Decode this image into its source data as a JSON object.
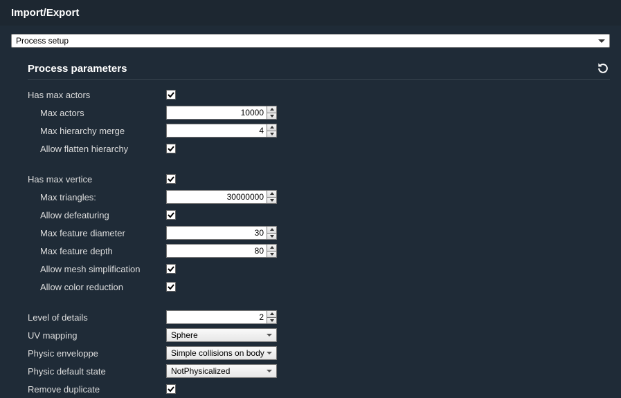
{
  "header": {
    "title": "Import/Export"
  },
  "mainDropdown": {
    "value": "Process setup"
  },
  "section": {
    "title": "Process parameters"
  },
  "p": {
    "hasMaxActors": {
      "label": "Has max actors",
      "checked": true
    },
    "maxActors": {
      "label": "Max actors",
      "value": "10000"
    },
    "maxHierarchyMerge": {
      "label": "Max hierarchy merge",
      "value": "4"
    },
    "allowFlatten": {
      "label": "Allow flatten hierarchy",
      "checked": true
    },
    "hasMaxVertice": {
      "label": "Has max vertice",
      "checked": true
    },
    "maxTriangles": {
      "label": "Max triangles:",
      "value": "30000000"
    },
    "allowDefeaturing": {
      "label": "Allow defeaturing",
      "checked": true
    },
    "maxFeatureDiameter": {
      "label": "Max feature diameter",
      "value": "30"
    },
    "maxFeatureDepth": {
      "label": "Max feature depth",
      "value": "80"
    },
    "allowMeshSimp": {
      "label": "Allow mesh simplification",
      "checked": true
    },
    "allowColorReduction": {
      "label": "Allow color reduction",
      "checked": true
    },
    "levelOfDetails": {
      "label": "Level of details",
      "value": "2"
    },
    "uvMapping": {
      "label": "UV mapping",
      "value": "Sphere"
    },
    "physicEnveloppe": {
      "label": "Physic enveloppe",
      "value": "Simple collisions on body"
    },
    "physicDefaultState": {
      "label": "Physic default state",
      "value": "NotPhysicalized"
    },
    "removeDuplicate": {
      "label": "Remove duplicate",
      "checked": true
    }
  }
}
